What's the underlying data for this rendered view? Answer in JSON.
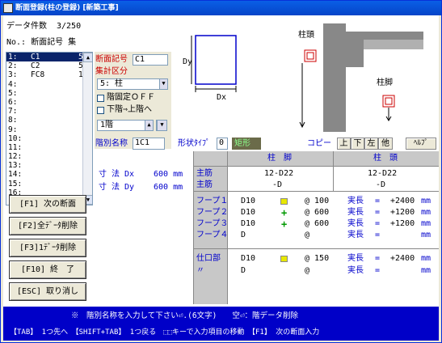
{
  "window": {
    "title": "断面登録(柱の登録) [新築工事]"
  },
  "header": {
    "count_label": "データ件数",
    "count_value": "3/250",
    "no_label": "No.: 断面記号 集"
  },
  "list": {
    "rows": [
      {
        "n": "1:",
        "name": "C1",
        "q": "5",
        "selected": true
      },
      {
        "n": "2:",
        "name": "C2",
        "q": "5"
      },
      {
        "n": "3:",
        "name": "FC8",
        "q": "1"
      },
      {
        "n": "4:",
        "name": "",
        "q": ""
      },
      {
        "n": "5:",
        "name": "",
        "q": ""
      },
      {
        "n": "6:",
        "name": "",
        "q": ""
      },
      {
        "n": "7:",
        "name": "",
        "q": ""
      },
      {
        "n": "8:",
        "name": "",
        "q": ""
      },
      {
        "n": "9:",
        "name": "",
        "q": ""
      },
      {
        "n": "10:",
        "name": "",
        "q": ""
      },
      {
        "n": "11:",
        "name": "",
        "q": ""
      },
      {
        "n": "12:",
        "name": "",
        "q": ""
      },
      {
        "n": "13:",
        "name": "",
        "q": ""
      },
      {
        "n": "14:",
        "name": "",
        "q": ""
      },
      {
        "n": "15:",
        "name": "",
        "q": ""
      },
      {
        "n": "16:",
        "name": "",
        "q": ""
      }
    ]
  },
  "form": {
    "section_label": "断面記号",
    "section_value": "C1",
    "category_label": "集計区分",
    "category_value": "5: 柱",
    "fixed_label": "階固定ＯＦＦ",
    "floor_label": "下階⇒上階へ",
    "floor_value": "1階",
    "floor_name_label": "階別名称",
    "floor_name_value": "1C1",
    "shape_type_label": "形状ﾀｲﾌﾟ",
    "shape_type_value": "0",
    "shape_name": "矩形",
    "copy_label": "コピー",
    "copy_up": "上",
    "copy_down": "下",
    "copy_left": "左",
    "copy_other": "他",
    "help": "ﾍﾙﾌﾟ"
  },
  "diagram": {
    "dy": "Dy",
    "dx": "Dx",
    "head": "柱頭",
    "foot": "柱脚"
  },
  "dims": {
    "dx_label": "寸 法 Dx",
    "dx_value": "600 mm",
    "dy_label": "寸 法 Dy",
    "dy_value": "600 mm"
  },
  "table": {
    "col_foot": "柱　脚",
    "col_head": "柱　頭",
    "main1_label": "主筋",
    "main1_foot": "12-D22",
    "main1_head": "12-D22",
    "main2_label": "主筋",
    "main2_foot": "-D",
    "main2_head": "-D",
    "hoops": [
      {
        "label": "フープ１",
        "bar": "D10",
        "sym": "square",
        "pitch": "@ 100",
        "len_label": "実長",
        "eq": "=",
        "len": "+2400",
        "unit": "mm"
      },
      {
        "label": "フープ２",
        "bar": "D10",
        "sym": "plus",
        "pitch": "@ 600",
        "len_label": "実長",
        "eq": "=",
        "len": "+1200",
        "unit": "mm"
      },
      {
        "label": "フープ３",
        "bar": "D10",
        "sym": "plus",
        "pitch": "@ 600",
        "len_label": "実長",
        "eq": "=",
        "len": "+1200",
        "unit": "mm"
      },
      {
        "label": "フープ４",
        "bar": "D",
        "sym": "",
        "pitch": "@",
        "len_label": "実長",
        "eq": "=",
        "len": "",
        "unit": "mm"
      }
    ],
    "shikuchi": [
      {
        "label": "仕口部",
        "bar": "D10",
        "sym": "square",
        "pitch": "@ 150",
        "len_label": "実長",
        "eq": "=",
        "len": "+2400",
        "unit": "mm"
      },
      {
        "label": "〃",
        "bar": "D",
        "sym": "",
        "pitch": "@",
        "len_label": "実長",
        "eq": "=",
        "len": "",
        "unit": "mm"
      }
    ]
  },
  "buttons": {
    "next": "[F1] 次の断面",
    "del_all": "[F2]全ﾃﾞｰﾀ削除",
    "del_one": "[F3]1ﾃﾞｰﾀ削除",
    "end": "[F10] 終　了",
    "cancel": "[ESC] 取り消し"
  },
  "status": {
    "line1": "※　階別名称を入力して下さい⏎.(6文字)　　空⏎：階データ削除",
    "line2": "【TAB】 1つ先へ　【SHIFT+TAB】 1つ戻る　⬚⬚キーで入力項目の移動　【F1】 次の断面入力"
  },
  "colors": {
    "accent": "#0000cc",
    "label_red": "#cc0000",
    "status_bg": "#0000c8"
  }
}
